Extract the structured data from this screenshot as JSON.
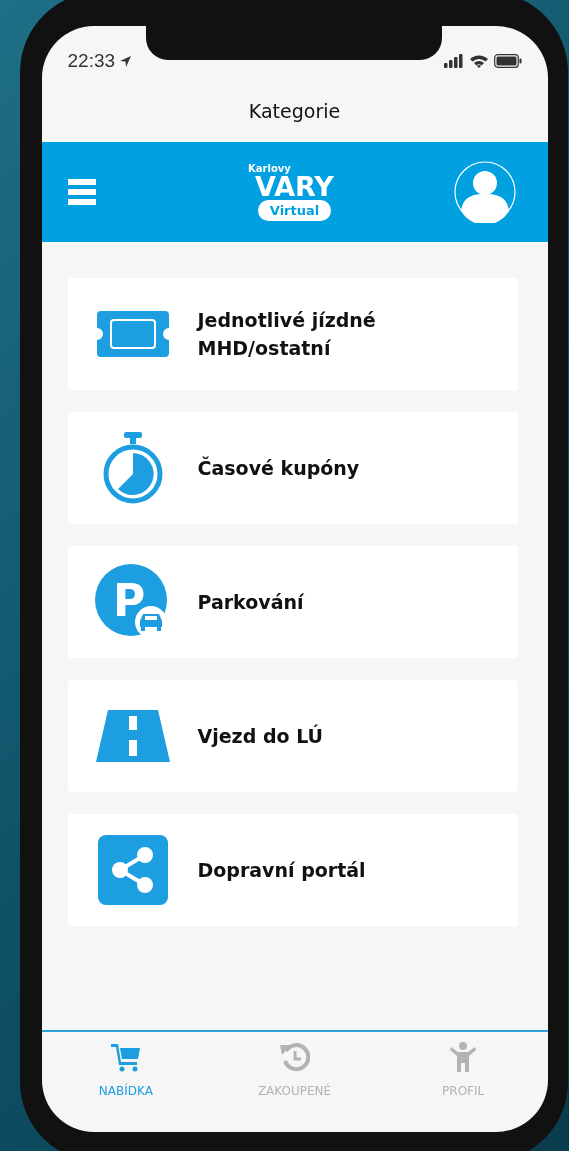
{
  "status_bar": {
    "time": "22:33"
  },
  "title": "Kategorie",
  "header": {
    "logo_small": "Karlovy",
    "logo_big": "VARY",
    "logo_badge": "Virtual"
  },
  "categories": [
    {
      "kind": "ticket",
      "label": "Jednotlivé jízdné MHD/ostatní"
    },
    {
      "kind": "stopwatch",
      "label": "Časové kupóny"
    },
    {
      "kind": "parking",
      "icon_letter": "P",
      "label": "Parkování"
    },
    {
      "kind": "road",
      "label": "Vjezd do LÚ"
    },
    {
      "kind": "share",
      "label": "Dopravní portál"
    }
  ],
  "tab_bar": [
    {
      "kind": "cart",
      "label": "NABÍDKA",
      "selected": true
    },
    {
      "kind": "history",
      "label": "ZAKOUPENÉ",
      "selected": false
    },
    {
      "kind": "person",
      "label": "PROFIL",
      "selected": false
    }
  ]
}
